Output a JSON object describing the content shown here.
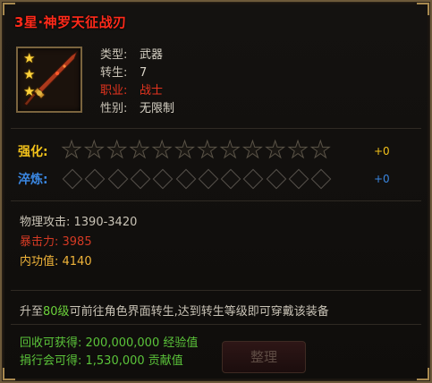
{
  "item": {
    "title": "3星·神罗天征战刃",
    "stars": 3,
    "type_label": "类型:",
    "type_value": "武器",
    "rebirth_label": "转生:",
    "rebirth_value": "7",
    "class_label": "职业:",
    "class_value": "战士",
    "gender_label": "性别:",
    "gender_value": "无限制"
  },
  "enhance": {
    "label": "强化:",
    "level_total": 12,
    "level": 0,
    "plus": "+0"
  },
  "refine": {
    "label": "淬炼:",
    "level_total": 12,
    "level": 0,
    "plus": "+0"
  },
  "stats": {
    "physical_attack": "物理攻击: 1390-3420",
    "crit": "暴击力: 3985",
    "inner_power": "内功值: 4140"
  },
  "description": {
    "prefix": "升至",
    "highlight": "80级",
    "suffix": "可前往角色界面转生,达到转生等级即可穿戴该装备"
  },
  "rewards": {
    "recycle": "回收可获得: 200,000,000 经验值",
    "rank": "捐行会可得: 1,530,000 贡献值"
  },
  "button": {
    "label": "整理"
  },
  "colors": {
    "title": "#ff2a1a",
    "enhance": "#f3c21a",
    "refine": "#3a86e0",
    "reward": "#5bc43a"
  }
}
